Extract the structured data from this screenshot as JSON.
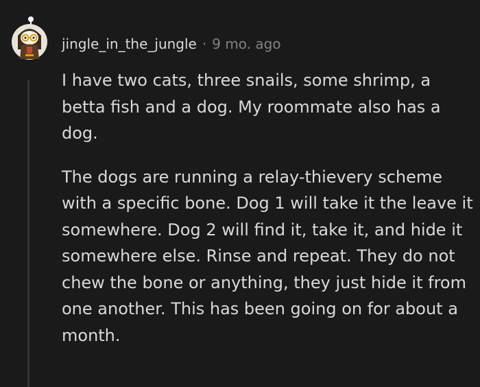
{
  "comment": {
    "username": "jingle_in_the_jungle",
    "separator": "·",
    "timestamp": "9 mo. ago",
    "avatar_icon": "snoo-avatar-icon",
    "paragraphs": [
      "I have two cats, three snails, some shrimp, a betta fish and a dog. My roommate also has a dog.",
      "The dogs are running a relay-thievery scheme with a specific bone. Dog 1 will take it the leave it somewhere. Dog 2 will find it, take it, and hide it somewhere else. Rinse and repeat. They do not chew the bone or anything, they just hide it from one another. This has been going on for about a month."
    ]
  },
  "colors": {
    "background": "#1a1a1b",
    "text": "#d7dadc",
    "meta": "#818384",
    "thread_line": "#343536"
  }
}
